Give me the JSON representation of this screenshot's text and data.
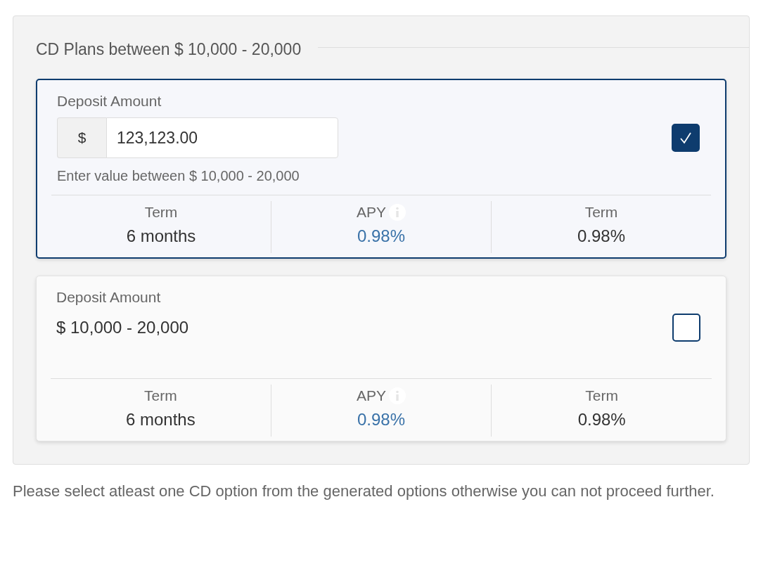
{
  "section": {
    "title": "CD Plans between $ 10,000 - 20,000"
  },
  "plans": [
    {
      "kind": "input",
      "selected": true,
      "deposit_label": "Deposit Amount",
      "currency": "$",
      "value": "123,123.00",
      "hint": "Enter value between $ 10,000 - 20,000",
      "stats": [
        {
          "label": "Term",
          "value": "6 months"
        },
        {
          "label": "APY",
          "value": "0.98%",
          "info": true
        },
        {
          "label": "Term",
          "value": "0.98%"
        }
      ]
    },
    {
      "kind": "range",
      "selected": false,
      "deposit_label": "Deposit Amount",
      "range": "$ 10,000 - 20,000",
      "stats": [
        {
          "label": "Term",
          "value": "6 months"
        },
        {
          "label": "APY",
          "value": "0.98%",
          "info": true
        },
        {
          "label": "Term",
          "value": "0.98%"
        }
      ]
    }
  ],
  "note": "Please select atleast one CD option from the generated options otherwise you can not proceed further."
}
